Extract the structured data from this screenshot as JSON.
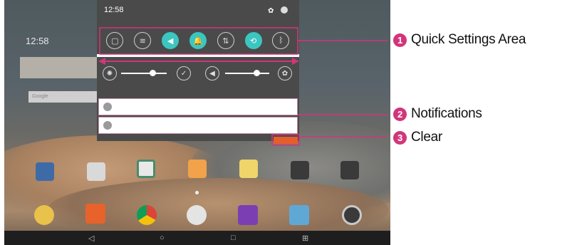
{
  "homescreen": {
    "widget_time": "12:58",
    "search_hint": "Google"
  },
  "shade": {
    "status_time": "12:58",
    "quick_settings": [
      {
        "name": "screenshot-icon",
        "glyph": "▢",
        "active": false
      },
      {
        "name": "wifi-icon",
        "glyph": "≋",
        "active": false
      },
      {
        "name": "sound-icon",
        "glyph": "◀",
        "active": true
      },
      {
        "name": "notification-bell-icon",
        "glyph": "🔔",
        "active": true
      },
      {
        "name": "data-sync-icon",
        "glyph": "⇅",
        "active": false
      },
      {
        "name": "rotation-icon",
        "glyph": "⟲",
        "active": true
      },
      {
        "name": "bluetooth-icon",
        "glyph": "ᛒ",
        "active": false
      }
    ]
  },
  "nav": {
    "back": "◁",
    "home": "○",
    "recents": "□",
    "dual_window": "⊞"
  },
  "callouts": [
    {
      "number": "1",
      "text": "Quick Settings Area"
    },
    {
      "number": "2",
      "text": "Notifications"
    },
    {
      "number": "3",
      "text": "Clear"
    }
  ],
  "colors": {
    "callout_accent": "#d2357a",
    "toggle_active": "#3bc6c0",
    "clear_button": "#e85d2c"
  }
}
